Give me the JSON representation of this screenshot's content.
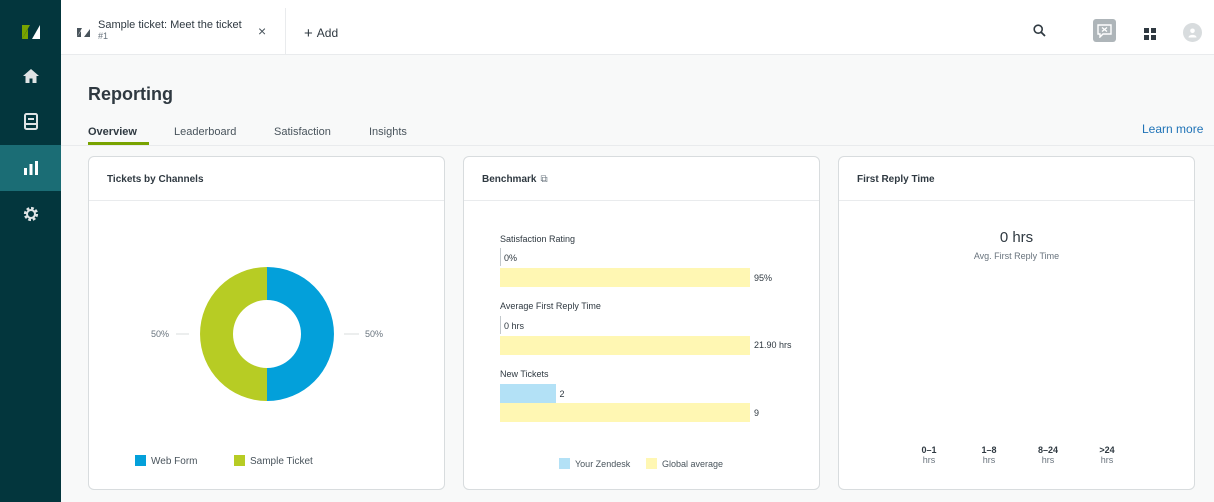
{
  "colors": {
    "sidebar": "#03363d",
    "web_form": "#03a0da",
    "sample_ticket": "#b7cc24",
    "your_zendesk": "#b3e1f6",
    "global_average": "#fff7b3",
    "accent": "#78a300",
    "link": "#1f73b7"
  },
  "icons": {
    "logo": "zendesk-logo-icon",
    "home": "home-icon",
    "views": "views-icon",
    "reporting": "reporting-icon",
    "admin": "gear-icon",
    "search": "search-icon",
    "chat": "chat-icon",
    "apps": "apps-grid-icon",
    "avatar": "avatar-icon"
  },
  "topbar": {
    "ticket_title": "Sample ticket: Meet the ticket",
    "ticket_number": "#1",
    "close": "×",
    "add_label": "Add"
  },
  "page": {
    "title": "Reporting",
    "learn_more": "Learn more"
  },
  "tabs": [
    {
      "label": "Overview"
    },
    {
      "label": "Leaderboard"
    },
    {
      "label": "Satisfaction"
    },
    {
      "label": "Insights"
    }
  ],
  "channels": {
    "title": "Tickets by Channels",
    "left_pct": "50%",
    "right_pct": "50%",
    "legend": [
      {
        "label": "Web Form"
      },
      {
        "label": "Sample Ticket"
      }
    ]
  },
  "chart_data": [
    {
      "type": "pie",
      "title": "Tickets by Channels",
      "categories": [
        "Web Form",
        "Sample Ticket"
      ],
      "values": [
        50,
        50
      ]
    },
    {
      "type": "bar",
      "title": "Benchmark",
      "categories": [
        "Satisfaction Rating",
        "Average First Reply Time",
        "New Tickets"
      ],
      "series": [
        {
          "name": "Your Zendesk",
          "values": [
            0,
            0,
            2
          ]
        },
        {
          "name": "Global average",
          "values": [
            95,
            21.9,
            9
          ]
        }
      ]
    }
  ],
  "benchmark": {
    "title": "Benchmark",
    "ext_icon": "⧉",
    "rows": [
      {
        "label": "Satisfaction Rating",
        "yours": "0%",
        "global": "95%"
      },
      {
        "label": "Average First Reply Time",
        "yours": "0 hrs",
        "global": "21.90 hrs"
      },
      {
        "label": "New Tickets",
        "yours": "2",
        "global": "9"
      }
    ],
    "legend": [
      {
        "label": "Your Zendesk"
      },
      {
        "label": "Global average"
      }
    ]
  },
  "first_reply": {
    "title": "First Reply Time",
    "value": "0 hrs",
    "caption": "Avg. First Reply Time",
    "buckets": [
      {
        "range": "0–1",
        "unit": "hrs"
      },
      {
        "range": "1–8",
        "unit": "hrs"
      },
      {
        "range": "8–24",
        "unit": "hrs"
      },
      {
        "range": ">24",
        "unit": "hrs"
      }
    ]
  }
}
